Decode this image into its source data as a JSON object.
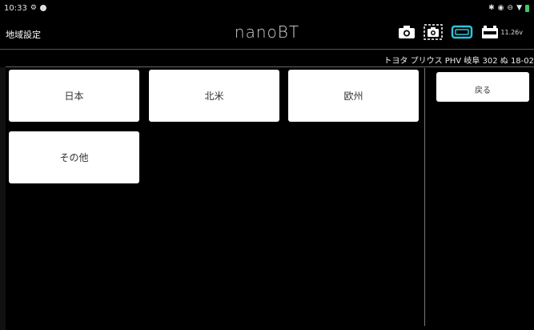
{
  "status_bar": {
    "time": "10:33",
    "icons": [
      "settings-icon",
      "info-icon",
      "bluetooth-icon",
      "data-saver-icon",
      "minus-circle-icon",
      "wifi-icon",
      "battery-icon"
    ]
  },
  "app_bar": {
    "screen_title": "地域設定",
    "brand_prefix": "nano",
    "brand_suffix": "BT",
    "voltage": "11.26v"
  },
  "vehicle_info": "トヨタ プリウス PHV 岐阜 302 ぬ 18-02",
  "regions": [
    {
      "label": "日本"
    },
    {
      "label": "北米"
    },
    {
      "label": "欧州"
    },
    {
      "label": "その他"
    }
  ],
  "side_panel": {
    "back_label": "戻る"
  },
  "colors": {
    "background": "#000000",
    "button": "#ffffff",
    "accent": "#2fc4d8"
  }
}
